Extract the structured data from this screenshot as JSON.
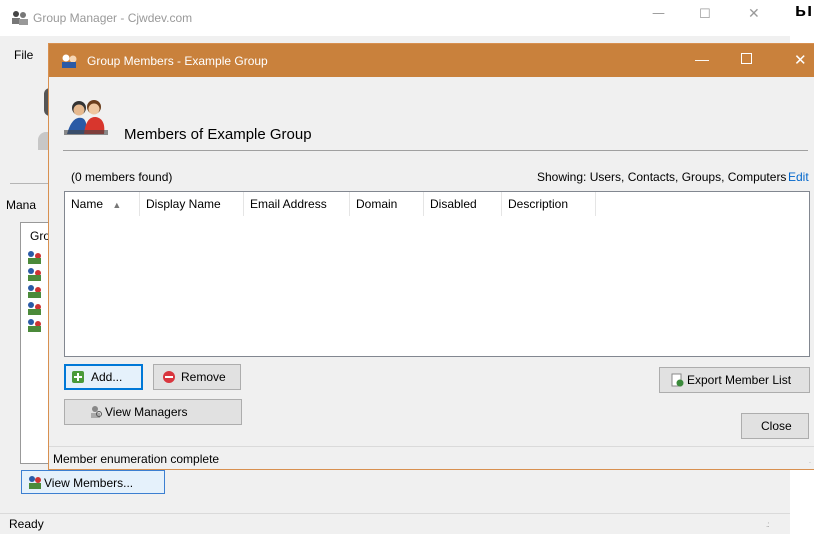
{
  "background_window": {
    "title": "Group Manager - Cjwdev.com",
    "menu_file": "File",
    "manage_label": "Mana",
    "group_header": "Gro",
    "view_members_label": "View Members...",
    "status": "Ready",
    "partial_text": "ьıı"
  },
  "dialog": {
    "title": "Group Members - Example Group",
    "header_title": "Members of Example Group",
    "count_label": "(0 members found)",
    "showing_label": "Showing:  Users, Contacts, Groups, Computers",
    "edit_link": "Edit",
    "columns": [
      "Name",
      "Display Name",
      "Email Address",
      "Domain",
      "Disabled",
      "Description"
    ],
    "buttons": {
      "add": "Add...",
      "remove": "Remove",
      "export": "Export Member List",
      "view_managers": "View Managers",
      "close": "Close"
    },
    "status": "Member enumeration complete"
  },
  "colors": {
    "dialog_titlebar": "#c9813c",
    "link": "#0066cc",
    "focus": "#0078d7"
  },
  "icons": [
    "group-icon",
    "members-icon",
    "add-icon",
    "remove-icon",
    "export-icon",
    "managers-icon",
    "sort-up-icon"
  ]
}
